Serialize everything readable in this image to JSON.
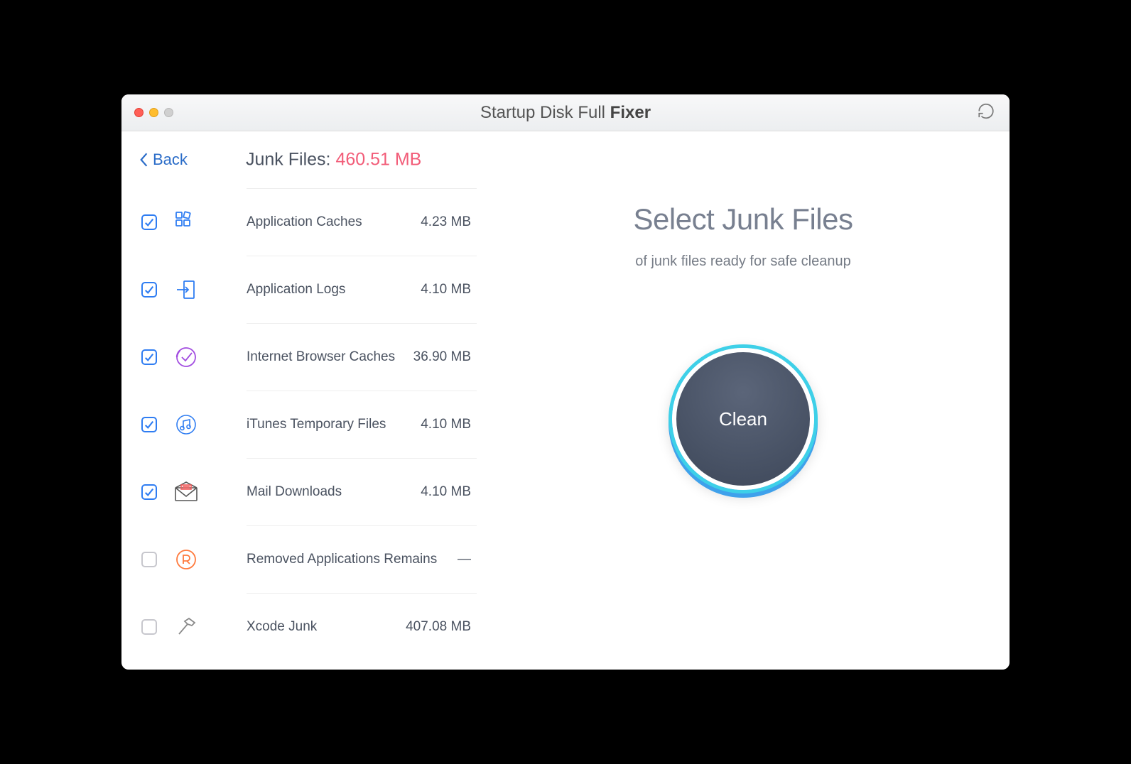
{
  "window": {
    "title_prefix": "Startup Disk Full ",
    "title_bold": "Fixer"
  },
  "sidebar": {
    "back_label": "Back",
    "summary_label": "Junk Files: ",
    "summary_size": "460.51 MB",
    "items": [
      {
        "label": "Application Caches",
        "size": "4.23 MB",
        "checked": true,
        "icon": "grid-icon",
        "color": "#2f7df2"
      },
      {
        "label": "Application Logs",
        "size": "4.10 MB",
        "checked": true,
        "icon": "log-icon",
        "color": "#2f7df2"
      },
      {
        "label": "Internet Browser Caches",
        "size": "36.90 MB",
        "checked": true,
        "icon": "browser-icon",
        "color": "#a24de0"
      },
      {
        "label": "iTunes Temporary Files",
        "size": "4.10 MB",
        "checked": true,
        "icon": "music-icon",
        "color": "#2f7df2"
      },
      {
        "label": "Mail Downloads",
        "size": "4.10 MB",
        "checked": true,
        "icon": "mail-icon",
        "color": "#f25c5c"
      },
      {
        "label": "Removed Applications Remains",
        "size": "—",
        "checked": false,
        "icon": "removed-icon",
        "color": "#ff7a3d"
      },
      {
        "label": "Xcode Junk",
        "size": "407.08 MB",
        "checked": false,
        "icon": "hammer-icon",
        "color": "#8a8a8a"
      }
    ]
  },
  "main": {
    "title": "Select Junk Files",
    "subtitle": "of junk files ready for safe cleanup",
    "clean_button": "Clean"
  }
}
